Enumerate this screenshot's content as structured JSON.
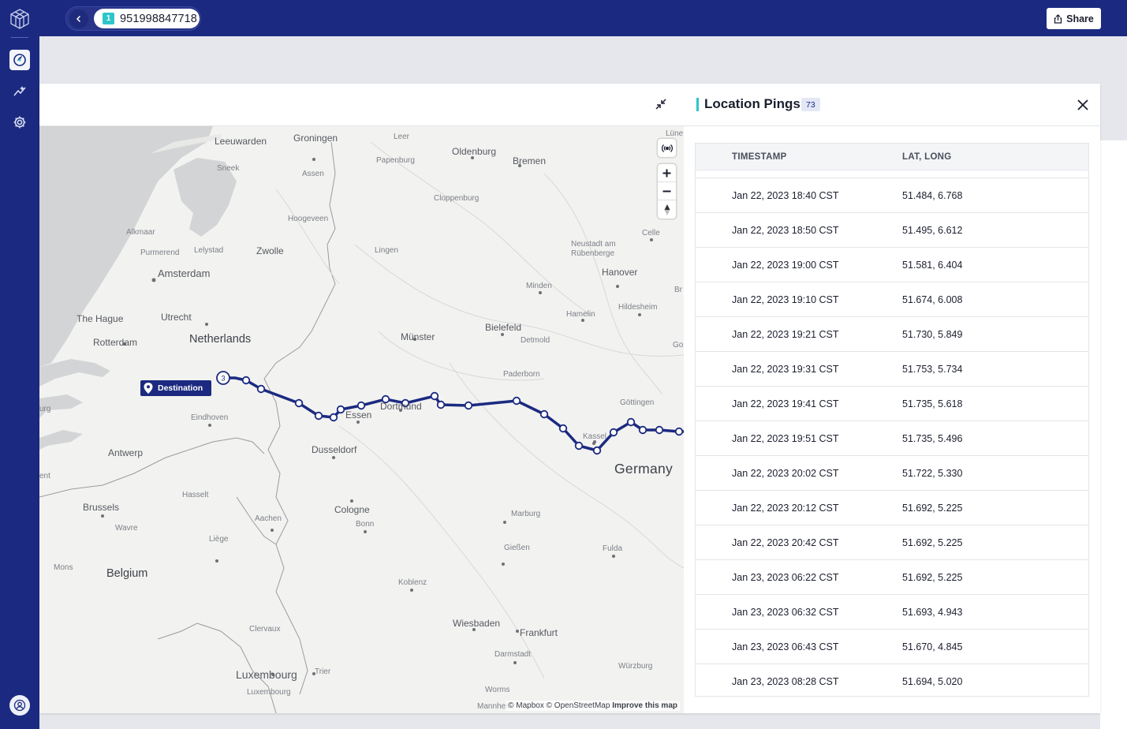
{
  "topbar": {
    "tracking_badge": "1",
    "tracking_number": "951998847718",
    "share_label": "Share"
  },
  "map": {
    "labels": {
      "leeuwarden": "Leeuwarden",
      "groningen": "Groningen",
      "leer": "Leer",
      "oldenburg": "Oldenburg",
      "bremen": "Bremen",
      "lune": "Lüne",
      "sneek": "Sneek",
      "assen": "Assen",
      "papenburg": "Papenburg",
      "cloppenburg": "Cloppenburg",
      "hoogeveen": "Hoogeveen",
      "alkmaar": "Alkmaar",
      "purmerend": "Purmerend",
      "lelystad": "Lelystad",
      "zwolle": "Zwolle",
      "lingen": "Lingen",
      "neustadt": "Neustadt am Rübenberge",
      "celle": "Celle",
      "amsterdam": "Amsterdam",
      "hanover": "Hanover",
      "minden": "Minden",
      "br": "Br",
      "hildesheim": "Hildesheim",
      "the_hague": "The Hague",
      "utrecht": "Utrecht",
      "hamelin": "Hamelin",
      "bielefeld": "Bielefeld",
      "rotterdam": "Rotterdam",
      "netherlands": "Netherlands",
      "munster": "Münster",
      "detmold": "Detmold",
      "go": "Go",
      "paderborn": "Paderborn",
      "eindhoven": "Eindhoven",
      "essen": "Essen",
      "dortmund": "Dortmund",
      "gottingen": "Göttingen",
      "urg": "urg",
      "kassel": "Kassel",
      "antwerp": "Antwerp",
      "dusseldorf": "Dusseldorf",
      "germany": "Germany",
      "ent": "ent",
      "hasselt": "Hasselt",
      "brussels": "Brussels",
      "cologne": "Cologne",
      "aachen": "Aachen",
      "wavre": "Wavre",
      "bonn": "Bonn",
      "marburg": "Marburg",
      "liege": "Liège",
      "giessen": "Gießen",
      "fulda": "Fulda",
      "mons": "Mons",
      "belgium": "Belgium",
      "koblenz": "Koblenz",
      "wiesbaden": "Wiesbaden",
      "frankfurt": "Frankfurt",
      "clervaux": "Clervaux",
      "darmstadt": "Darmstadt",
      "wurzburg": "Würzburg",
      "luxembourg_country": "Luxembourg",
      "trier": "Trier",
      "luxembourg_city": "Luxembourg",
      "worms": "Worms",
      "mannheim": "Mannheim"
    },
    "destination_label": "Destination",
    "cluster_count": "3",
    "attribution": {
      "mapbox": "© Mapbox",
      "osm": "© OpenStreetMap",
      "improve": "Improve this map"
    },
    "route_color": "#1b2a80"
  },
  "panel": {
    "title": "Location Pings",
    "count": "73",
    "columns": {
      "timestamp": "TIMESTAMP",
      "latlong": "LAT, LONG"
    },
    "rows": [
      {
        "timestamp": "Jan 22, 2023 18:40 CST",
        "latlong": "51.484, 6.768"
      },
      {
        "timestamp": "Jan 22, 2023 18:50 CST",
        "latlong": "51.495, 6.612"
      },
      {
        "timestamp": "Jan 22, 2023 19:00 CST",
        "latlong": "51.581, 6.404"
      },
      {
        "timestamp": "Jan 22, 2023 19:10 CST",
        "latlong": "51.674, 6.008"
      },
      {
        "timestamp": "Jan 22, 2023 19:21 CST",
        "latlong": "51.730, 5.849"
      },
      {
        "timestamp": "Jan 22, 2023 19:31 CST",
        "latlong": "51.753, 5.734"
      },
      {
        "timestamp": "Jan 22, 2023 19:41 CST",
        "latlong": "51.735, 5.618"
      },
      {
        "timestamp": "Jan 22, 2023 19:51 CST",
        "latlong": "51.735, 5.496"
      },
      {
        "timestamp": "Jan 22, 2023 20:02 CST",
        "latlong": "51.722, 5.330"
      },
      {
        "timestamp": "Jan 22, 2023 20:12 CST",
        "latlong": "51.692, 5.225"
      },
      {
        "timestamp": "Jan 22, 2023 20:42 CST",
        "latlong": "51.692, 5.225"
      },
      {
        "timestamp": "Jan 23, 2023 06:22 CST",
        "latlong": "51.692, 5.225"
      },
      {
        "timestamp": "Jan 23, 2023 06:32 CST",
        "latlong": "51.693, 4.943"
      },
      {
        "timestamp": "Jan 23, 2023 06:43 CST",
        "latlong": "51.670, 4.845"
      },
      {
        "timestamp": "Jan 23, 2023 08:28 CST",
        "latlong": "51.694, 5.020"
      }
    ]
  },
  "colors": {
    "nav": "#1b2a80",
    "accent": "#2ec5c8"
  }
}
